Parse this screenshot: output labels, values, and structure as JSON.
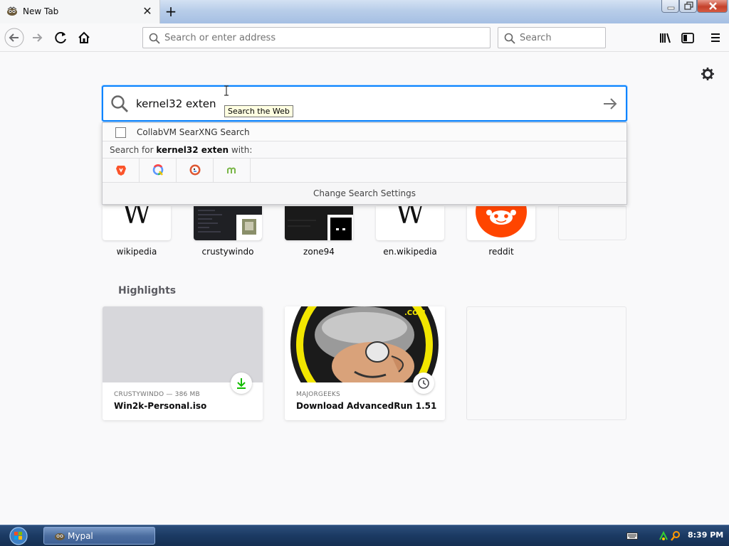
{
  "tab": {
    "title": "New Tab",
    "close_glyph": "✕",
    "new_tab_glyph": "+"
  },
  "toolbar": {
    "address_placeholder": "Search or enter address",
    "search_placeholder": "Search"
  },
  "hero_search": {
    "value": "kernel32 exten",
    "tooltip": "Search the Web"
  },
  "dropdown": {
    "suggestion_label": "CollabVM SearXNG Search",
    "search_for_prefix": "Search for",
    "search_for_query": "kernel32 exten",
    "search_for_suffix": "with:",
    "engines": [
      "brave-icon",
      "qwant-icon",
      "duckduckgo-icon",
      "mojeek-icon"
    ],
    "change_settings": "Change Search Settings"
  },
  "top_sites": [
    {
      "label": "wikipedia"
    },
    {
      "label": "crustywindo"
    },
    {
      "label": "zone94"
    },
    {
      "label": "en.wikipedia"
    },
    {
      "label": "reddit"
    }
  ],
  "highlights": {
    "title": "Highlights",
    "cards": [
      {
        "source": "CRUSTYWINDO — 386 MB",
        "title": "Win2k-Personal.iso",
        "badge": "download-icon"
      },
      {
        "source": "MAJORGEEKS",
        "title": "Download AdvancedRun 1.51",
        "badge": "history-icon"
      }
    ]
  },
  "taskbar": {
    "window_label": "Mypal",
    "clock": "8:39 PM"
  },
  "colors": {
    "focus_blue": "#0a84ff",
    "reddit": "#ff4500",
    "download_green": "#12bc00"
  }
}
